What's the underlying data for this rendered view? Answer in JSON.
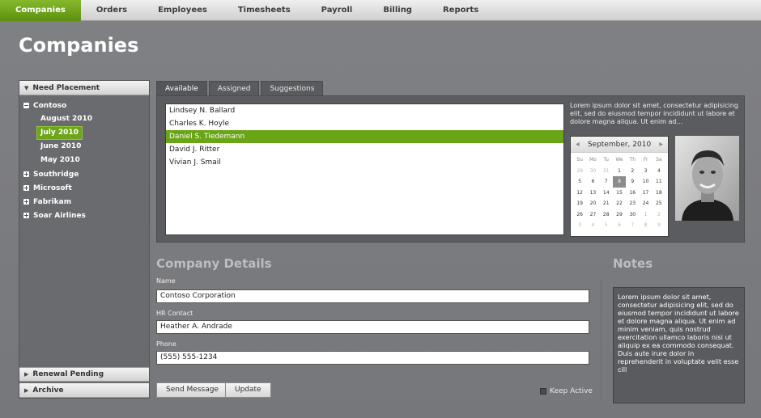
{
  "nav": {
    "items": [
      "Companies",
      "Orders",
      "Employees",
      "Timesheets",
      "Payroll",
      "Billing",
      "Reports"
    ],
    "active_index": 0
  },
  "page_title": "Companies",
  "sidebar": {
    "need_placement": "Need Placement",
    "tree": {
      "company": "Contoso",
      "months": [
        "August 2010",
        "July 2010",
        "June 2010",
        "May 2010"
      ],
      "selected_month": "July 2010",
      "others": [
        "Southridge",
        "Microsoft",
        "Fabrikam",
        "Soar Airlines"
      ]
    },
    "renewal_pending": "Renewal Pending",
    "archive": "Archive"
  },
  "tabs": [
    "Available",
    "Assigned",
    "Suggestions"
  ],
  "candidates": [
    "Lindsey N. Ballard",
    "Charles K. Hoyle",
    "Daniel S. Tiedemann",
    "David J. Ritter",
    "Vivian J. Smail"
  ],
  "selected_candidate": "Daniel S. Tiedemann",
  "blurb": "Lorem ipsum dolor sit amet, consectetur adipisicing elit, sed do eiusmod tempor incididunt ut labore et dolore magna aliqua. Ut enim ad...",
  "calendar": {
    "title": "September, 2010",
    "days_of_week": [
      "Su",
      "Mo",
      "Tu",
      "We",
      "Th",
      "Fr",
      "Sa"
    ],
    "weeks": [
      [
        "29",
        "30",
        "31",
        "1",
        "2",
        "3",
        "4"
      ],
      [
        "5",
        "6",
        "7",
        "8",
        "9",
        "10",
        "11"
      ],
      [
        "12",
        "13",
        "14",
        "15",
        "16",
        "17",
        "18"
      ],
      [
        "19",
        "20",
        "21",
        "22",
        "23",
        "24",
        "25"
      ],
      [
        "26",
        "27",
        "28",
        "29",
        "30",
        "1",
        "2"
      ],
      [
        "3",
        "4",
        "5",
        "6",
        "7",
        "8",
        "9"
      ]
    ],
    "selected_day": "8"
  },
  "details": {
    "heading": "Company Details",
    "name_label": "Name",
    "name_value": "Contoso Corporation",
    "hr_label": "HR Contact",
    "hr_value": "Heather A. Andrade",
    "phone_label": "Phone",
    "phone_value": "(555) 555-1234",
    "send_message": "Send Message",
    "update": "Update",
    "keep_active": "Keep Active"
  },
  "notes": {
    "heading": "Notes",
    "text": "Lorem ipsum dolor sit amet, consectetur adipisicing elit, sed do eiusmod tempor incididunt ut labore et dolore magna aliqua. Ut enim ad minim veniam, quis nostrud exercitation ullamco laboris nisi ut aliquip ex ea commodo consequat. Duis aute irure dolor in reprehenderit in voluptate velit esse cill"
  }
}
